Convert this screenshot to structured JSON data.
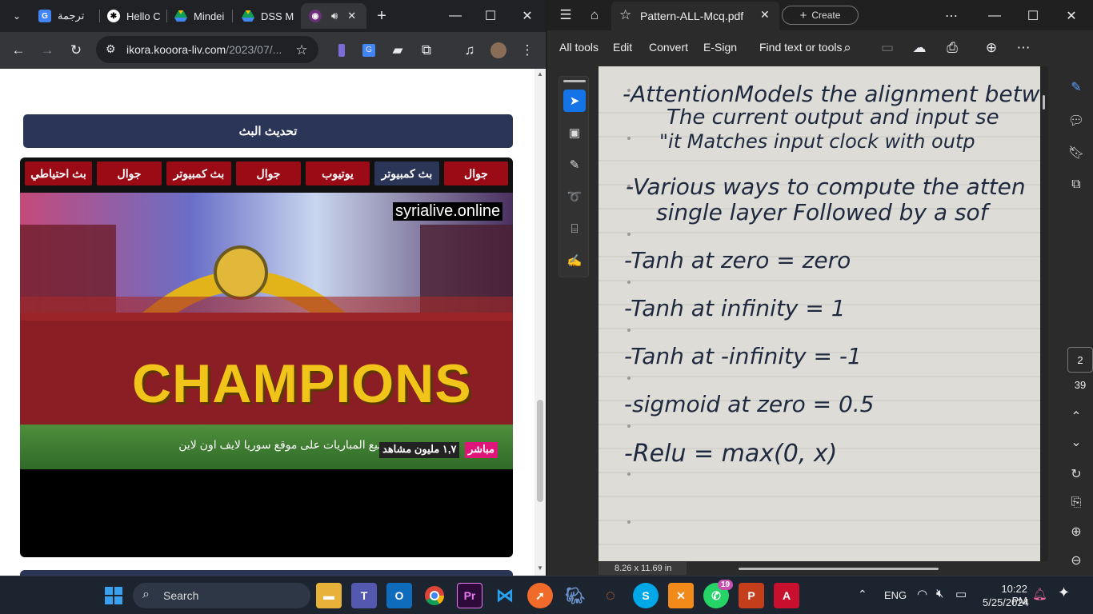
{
  "chrome": {
    "tabs": [
      {
        "label": "ترجمة"
      },
      {
        "label": "Hello C"
      },
      {
        "label": "Mindei"
      },
      {
        "label": "DSS M"
      },
      {
        "label": ""
      }
    ],
    "address": {
      "domain": "ikora.kooora-liv.com",
      "path": "/2023/07/..."
    },
    "page": {
      "refresh_button": "تحديث البث",
      "stream_buttons": [
        "جوال",
        "بث كمبيوتر",
        "يوتيوب",
        "جوال",
        "بث كمبيوتر",
        "جوال",
        "بث احتياطي"
      ],
      "video": {
        "watermark": "syrialive.online",
        "banner_text": "CHAMPIONS",
        "ticker": "جميع المباريات على موقع سوريا لايف اون لاين",
        "live_badge": "مباشر",
        "views": "١,٧ مليون مشاهد"
      }
    }
  },
  "acrobat": {
    "tab_title": "Pattern-ALL-Mcq.pdf",
    "create_label": "Create",
    "menu": [
      "All tools",
      "Edit",
      "Convert",
      "E-Sign"
    ],
    "find": "Find text or tools",
    "page_current": "2",
    "page_total": "39",
    "page_size": "8.26 x 11.69 in",
    "notes": [
      "-AttentionModels the alignment betw",
      "The current output and input se",
      "\"it Matches input clock with outp",
      "-Various ways to compute the atten",
      "single layer Followed by a sof",
      "-Tanh at zero = zero",
      "-Tanh at infinity = 1",
      "-Tanh at -infinity = -1",
      "-sigmoid at zero = 0.5",
      "-Relu = max(0, x)"
    ]
  },
  "taskbar": {
    "search_label": "Search",
    "whatsapp_badge": "19",
    "language": "ENG",
    "time": "10:22 PM",
    "date": "5/25/2024"
  }
}
